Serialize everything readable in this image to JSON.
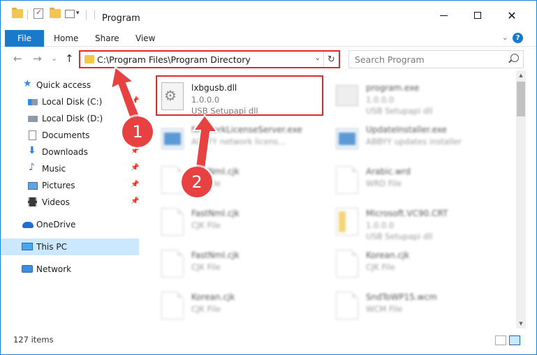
{
  "window": {
    "title": "Program",
    "minimize": "",
    "maximize": "",
    "close": "✕"
  },
  "ribbon": {
    "tabs": [
      "File",
      "Home",
      "Share",
      "View"
    ],
    "help": "?"
  },
  "navigation": {
    "back": "←",
    "forward": "→",
    "recent": "⌄",
    "up": "↑",
    "address_path": "C:\\Program Files\\Program Directory",
    "refresh": "↻",
    "search_placeholder": "Search Program"
  },
  "sidebar": {
    "items": [
      {
        "label": "Quick access",
        "icon": "star-icon"
      },
      {
        "label": "Local Disk (C:)",
        "icon": "disk-icon",
        "pinned": true
      },
      {
        "label": "Local Disk (D:)",
        "icon": "disk-icon"
      },
      {
        "label": "Documents",
        "icon": "documents-icon",
        "pinned": true
      },
      {
        "label": "Downloads",
        "icon": "downloads-icon",
        "pinned": true
      },
      {
        "label": "Music",
        "icon": "music-icon",
        "pinned": true
      },
      {
        "label": "Pictures",
        "icon": "pictures-icon",
        "pinned": true
      },
      {
        "label": "Videos",
        "icon": "videos-icon",
        "pinned": true
      },
      {
        "label": "OneDrive",
        "icon": "onedrive-icon"
      },
      {
        "label": "This PC",
        "icon": "this-pc-icon",
        "selected": true
      },
      {
        "label": "Network",
        "icon": "network-icon"
      }
    ]
  },
  "files": [
    {
      "name": "lxbgusb.dll",
      "line1": "1.0.0.0",
      "line2": "USB Setupapi dll",
      "icon": "dll-file-icon",
      "highlighted": true
    },
    {
      "name": "program.exe",
      "line1": "1.0.0.0",
      "line2": "USB Setupapi dll",
      "icon": "program-icon"
    },
    {
      "name": "NetworkLicenseServer.exe",
      "line1": "ABBYY network licens...",
      "line2": "",
      "icon": "application-icon"
    },
    {
      "name": "UpdateInstaller.exe",
      "line1": "ABBYY updates installer",
      "line2": "",
      "icon": "application-icon"
    },
    {
      "name": "FastNml.cjk",
      "line1": "CJK File",
      "line2": "",
      "icon": "file-icon"
    },
    {
      "name": "Arabic.wrd",
      "line1": "WRD File",
      "line2": "",
      "icon": "file-icon"
    },
    {
      "name": "FastNml.cjk",
      "line1": "CJK File",
      "line2": "",
      "icon": "file-icon"
    },
    {
      "name": "Microsoft.VC90.CRT",
      "line1": "1.0.0.0",
      "line2": "USB Setupapi dll",
      "icon": "vc-runtime-icon"
    },
    {
      "name": "FastNml.cjk",
      "line1": "CJK File",
      "line2": "",
      "icon": "file-icon"
    },
    {
      "name": "Korean.cjk",
      "line1": "CJK File",
      "line2": "",
      "icon": "file-icon"
    },
    {
      "name": "Korean.cjk",
      "line1": "CJK File",
      "line2": "",
      "icon": "file-icon"
    },
    {
      "name": "SndToWP15.wcm",
      "line1": "WCM File",
      "line2": "",
      "icon": "file-icon"
    }
  ],
  "status": {
    "item_count": "127 items"
  },
  "callouts": [
    {
      "number": "1"
    },
    {
      "number": "2"
    }
  ],
  "colors": {
    "accent": "#1979ca",
    "selection": "#cce8ff",
    "callout": "#e84141"
  }
}
